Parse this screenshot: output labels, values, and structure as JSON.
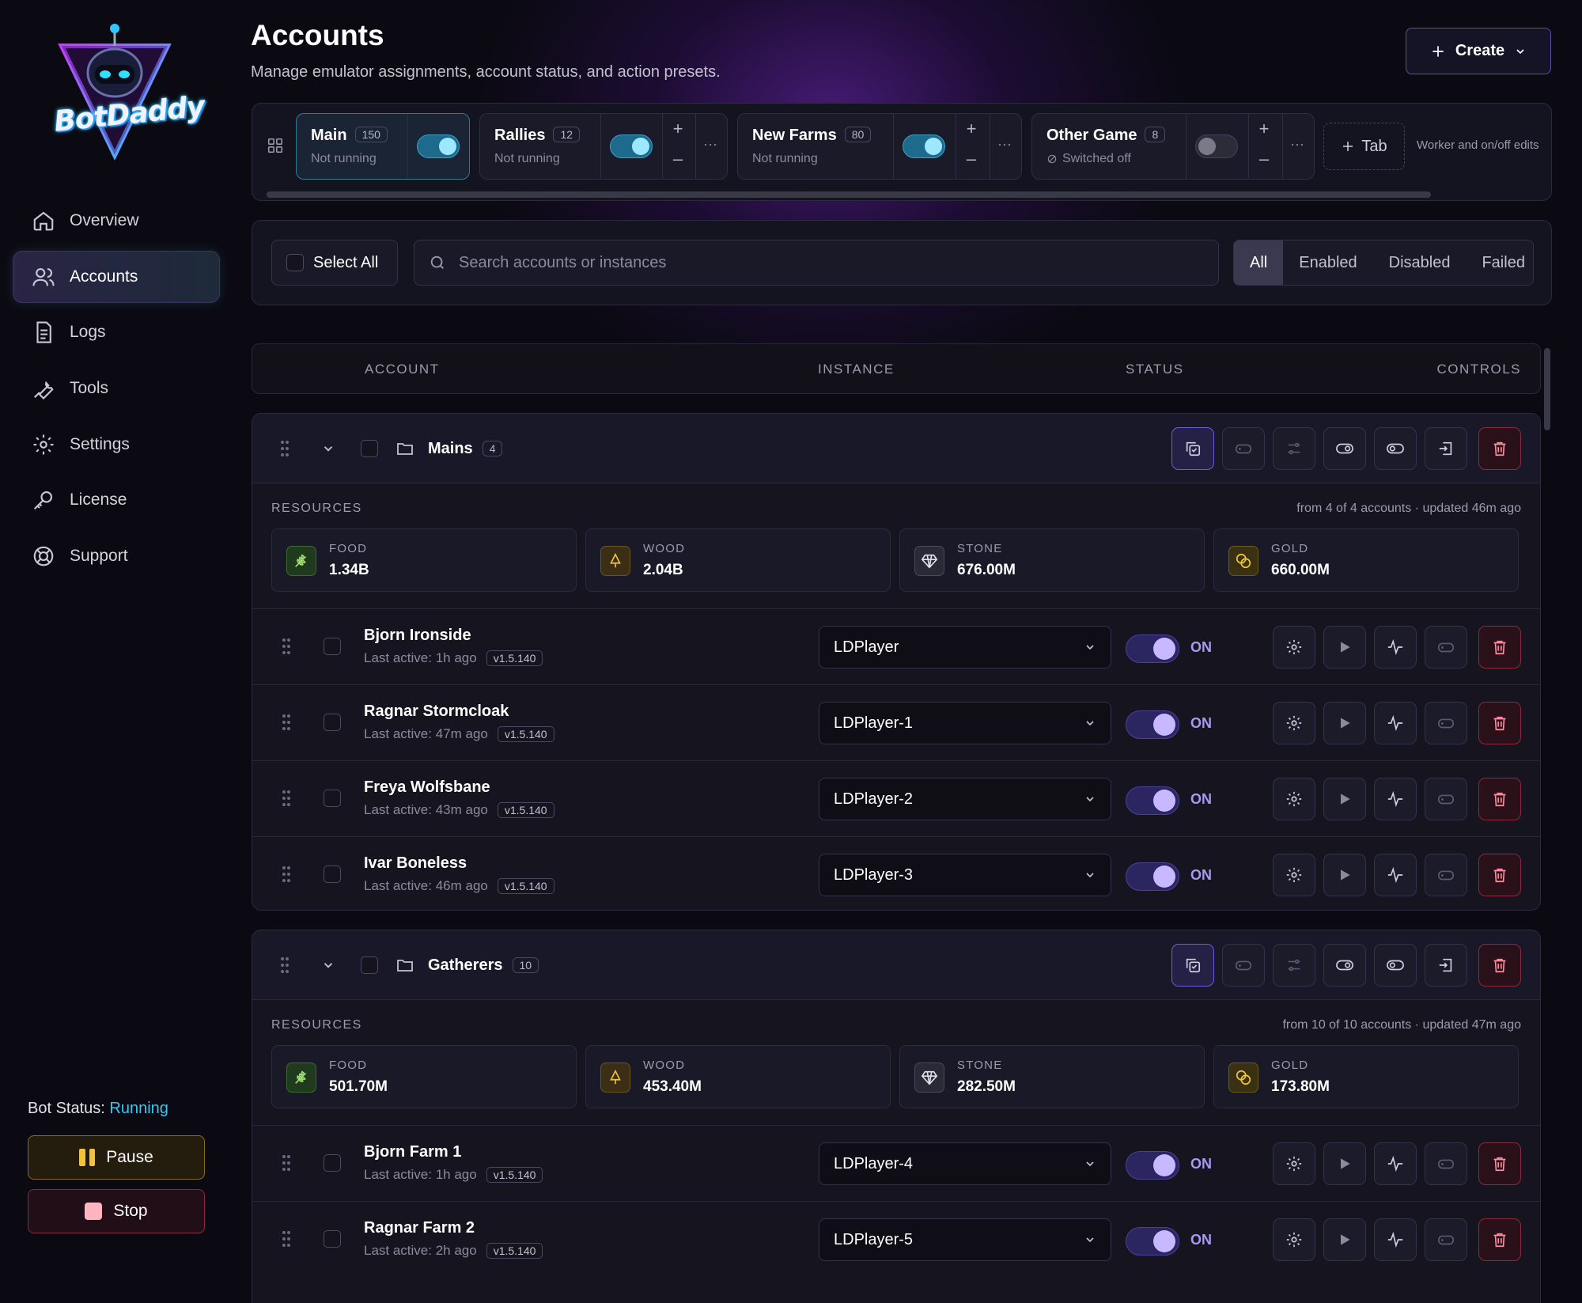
{
  "brand": {
    "name": "BotDaddy"
  },
  "nav": [
    {
      "label": "Overview",
      "icon": "home-icon"
    },
    {
      "label": "Accounts",
      "icon": "users-icon",
      "active": true
    },
    {
      "label": "Logs",
      "icon": "document-icon"
    },
    {
      "label": "Tools",
      "icon": "wrench-icon"
    },
    {
      "label": "Settings",
      "icon": "gear-icon"
    },
    {
      "label": "License",
      "icon": "key-icon"
    },
    {
      "label": "Support",
      "icon": "lifebuoy-icon"
    }
  ],
  "bot": {
    "status_label": "Bot Status:",
    "status_value": "Running",
    "pause_label": "Pause",
    "stop_label": "Stop"
  },
  "page": {
    "title": "Accounts",
    "subtitle": "Manage emulator assignments, account status, and action presets.",
    "create_label": "Create"
  },
  "tabs": [
    {
      "name": "Main",
      "count": "150",
      "status": "Not running",
      "enabled": true
    },
    {
      "name": "Rallies",
      "count": "12",
      "status": "Not running",
      "enabled": true
    },
    {
      "name": "New Farms",
      "count": "80",
      "status": "Not running",
      "enabled": true
    },
    {
      "name": "Other Game",
      "count": "8",
      "status": "Switched off",
      "enabled": false
    }
  ],
  "tab_controls": {
    "plus": "+",
    "minus": "–",
    "more": "···",
    "add_label": "Tab",
    "note": "Worker and on/off edits"
  },
  "filters": {
    "select_all": "Select All",
    "search_placeholder": "Search accounts or instances",
    "segments": [
      "All",
      "Enabled",
      "Disabled",
      "Failed"
    ],
    "active_segment": "All"
  },
  "columns": {
    "account": "ACCOUNT",
    "instance": "INSTANCE",
    "status": "STATUS",
    "controls": "CONTROLS"
  },
  "colors": {
    "accent": "#35c8f0",
    "on": "#a898f0",
    "danger": "#ff8ca0",
    "pause": "#f2c23a"
  },
  "groups": [
    {
      "name": "Mains",
      "count": "4",
      "resources_label": "RESOURCES",
      "resources_note": "from 4 of 4 accounts · updated 46m ago",
      "resources": [
        {
          "label": "FOOD",
          "value": "1.34B"
        },
        {
          "label": "WOOD",
          "value": "2.04B"
        },
        {
          "label": "STONE",
          "value": "676.00M"
        },
        {
          "label": "GOLD",
          "value": "660.00M"
        }
      ],
      "accounts": [
        {
          "name": "Bjorn Ironside",
          "last_active": "Last active: 1h ago",
          "version": "v1.5.140",
          "instance": "LDPlayer",
          "status": "ON"
        },
        {
          "name": "Ragnar Stormcloak",
          "last_active": "Last active: 47m ago",
          "version": "v1.5.140",
          "instance": "LDPlayer-1",
          "status": "ON"
        },
        {
          "name": "Freya Wolfsbane",
          "last_active": "Last active: 43m ago",
          "version": "v1.5.140",
          "instance": "LDPlayer-2",
          "status": "ON"
        },
        {
          "name": "Ivar Boneless",
          "last_active": "Last active: 46m ago",
          "version": "v1.5.140",
          "instance": "LDPlayer-3",
          "status": "ON"
        }
      ]
    },
    {
      "name": "Gatherers",
      "count": "10",
      "resources_label": "RESOURCES",
      "resources_note": "from 10 of 10 accounts · updated 47m ago",
      "resources": [
        {
          "label": "FOOD",
          "value": "501.70M"
        },
        {
          "label": "WOOD",
          "value": "453.40M"
        },
        {
          "label": "STONE",
          "value": "282.50M"
        },
        {
          "label": "GOLD",
          "value": "173.80M"
        }
      ],
      "accounts": [
        {
          "name": "Bjorn Farm 1",
          "last_active": "Last active: 1h ago",
          "version": "v1.5.140",
          "instance": "LDPlayer-4",
          "status": "ON"
        },
        {
          "name": "Ragnar Farm 2",
          "last_active": "Last active: 2h ago",
          "version": "v1.5.140",
          "instance": "LDPlayer-5",
          "status": "ON"
        }
      ]
    }
  ]
}
